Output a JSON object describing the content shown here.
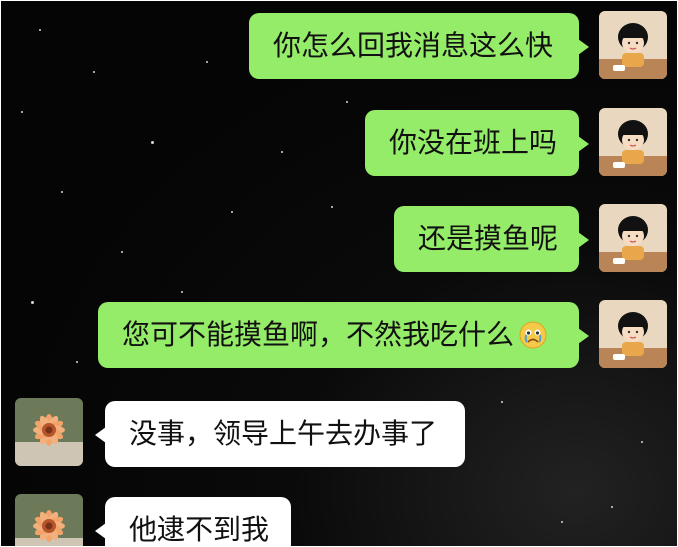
{
  "messages": [
    {
      "sender": "me",
      "text": "你怎么回我消息这么快"
    },
    {
      "sender": "me",
      "text": "你没在班上吗"
    },
    {
      "sender": "me",
      "text": "还是摸鱼呢"
    },
    {
      "sender": "me",
      "text": "您可不能摸鱼啊，不然我吃什么",
      "emoji": "crying-face-icon"
    },
    {
      "sender": "other",
      "text": "没事，领导上午去办事了"
    },
    {
      "sender": "other",
      "text": "他逮不到我"
    }
  ],
  "colors": {
    "sent_bubble": "#95ec69",
    "received_bubble": "#ffffff",
    "background": "#050505"
  },
  "avatars": {
    "me": "cartoon-girl-avatar-icon",
    "other": "flower-avatar-icon"
  }
}
